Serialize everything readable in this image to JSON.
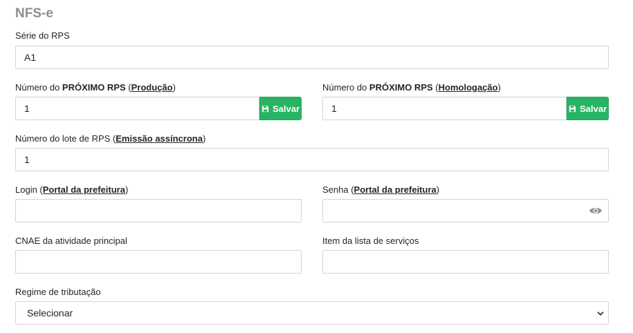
{
  "section": {
    "title": "NFS-e"
  },
  "serie": {
    "label": "Série do RPS",
    "value": "A1"
  },
  "rps_producao": {
    "label_prefix": "Número do ",
    "label_bold": "PRÓXIMO RPS",
    "label_open": " (",
    "label_link": "Produção",
    "label_close": ")",
    "value": "1",
    "save_label": "Salvar"
  },
  "rps_homologacao": {
    "label_prefix": "Número do ",
    "label_bold": "PRÓXIMO RPS",
    "label_open": " (",
    "label_link": "Homologação",
    "label_close": ")",
    "value": "1",
    "save_label": "Salvar"
  },
  "lote": {
    "label_prefix": "Número do lote de RPS (",
    "label_link": "Emissão assíncrona",
    "label_close": ")",
    "value": "1"
  },
  "login": {
    "label_prefix": "Login (",
    "label_link": "Portal da prefeitura",
    "label_close": ")",
    "value": ""
  },
  "senha": {
    "label_prefix": "Senha (",
    "label_link": "Portal da prefeitura",
    "label_close": ")",
    "value": "",
    "toggle_icon": "eye-icon"
  },
  "cnae": {
    "label": "CNAE da atividade principal",
    "value": ""
  },
  "item_servico": {
    "label": "Item da lista de serviços",
    "value": ""
  },
  "regime": {
    "label": "Regime de tributação",
    "selected": "Selecionar",
    "icon": "chevron-down-icon"
  },
  "colors": {
    "save_button": "#28b463",
    "title": "#8a8f94",
    "border": "#ced4da"
  }
}
